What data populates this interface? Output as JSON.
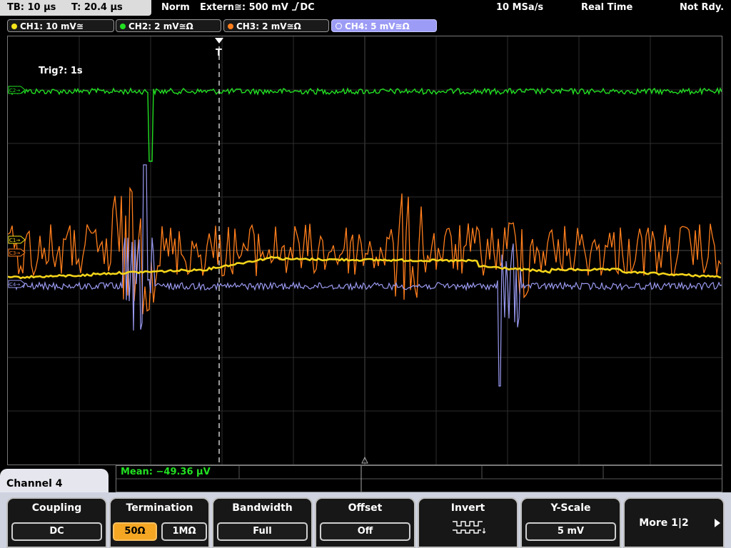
{
  "status": {
    "timebase": "TB: 10 μs",
    "trigger_time": "T: 20.4 μs",
    "mode": "Norm",
    "trigger_source": "Extern≅: 500 mV",
    "trigger_coupling": "DC",
    "sample_rate": "10 MSa/s",
    "acq_mode": "Real Time",
    "ready_state": "Not Rdy."
  },
  "channels": [
    {
      "label": "CH1: 10 mV≅",
      "color": "#f5e51a"
    },
    {
      "label": "CH2: 2 mV≅Ω",
      "color": "#22e022"
    },
    {
      "label": "CH3: 2 mV≅Ω",
      "color": "#ff7e1c"
    },
    {
      "label": "CH4: 5 mV≅Ω",
      "color": "#9a9af2"
    }
  ],
  "screen": {
    "trigger_info": "Trig?: 1s",
    "trigger_marker": "T",
    "markers": {
      "ch2": "C2→",
      "ch1": "C1→",
      "ch3": "C3→",
      "ch4": "C4→"
    }
  },
  "measurement": {
    "text": "Mean: −49.36 μV",
    "color": "#22e022"
  },
  "menu": {
    "channel_title": "Channel 4",
    "softkeys": {
      "coupling": {
        "label": "Coupling",
        "value": "DC"
      },
      "termination": {
        "label": "Termination",
        "option_a": "50Ω",
        "option_b": "1MΩ"
      },
      "bandwidth": {
        "label": "Bandwidth",
        "value": "Full"
      },
      "offset": {
        "label": "Offset",
        "value": "Off"
      },
      "invert": {
        "label": "Invert",
        "icon": "square-wave-invert-icon"
      },
      "yscale": {
        "label": "Y-Scale",
        "value": "5 mV"
      },
      "more": {
        "label": "More 1|2",
        "icon": "arrow-right-icon"
      }
    }
  }
}
